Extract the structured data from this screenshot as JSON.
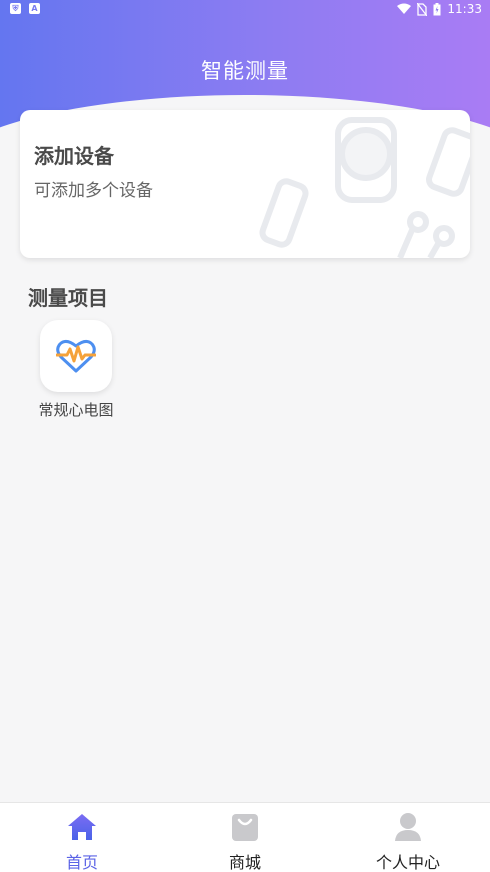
{
  "status_bar": {
    "time": "11:33"
  },
  "header": {
    "title": "智能测量"
  },
  "add_device_card": {
    "title": "添加设备",
    "subtitle": "可添加多个设备"
  },
  "measure_section": {
    "title": "测量项目",
    "items": [
      {
        "label": "常规心电图",
        "icon": "heart-ecg-icon"
      }
    ]
  },
  "bottom_nav": {
    "items": [
      {
        "label": "首页",
        "icon": "home-icon",
        "active": true
      },
      {
        "label": "商城",
        "icon": "shopping-bag-icon",
        "active": false
      },
      {
        "label": "个人中心",
        "icon": "person-icon",
        "active": false
      }
    ]
  },
  "colors": {
    "header_gradient_start": "#6476f0",
    "header_gradient_end": "#a97cf4",
    "active_nav": "#5b63e6",
    "ecg_orange": "#f5a23a",
    "heart_blue": "#4d8ff0"
  }
}
